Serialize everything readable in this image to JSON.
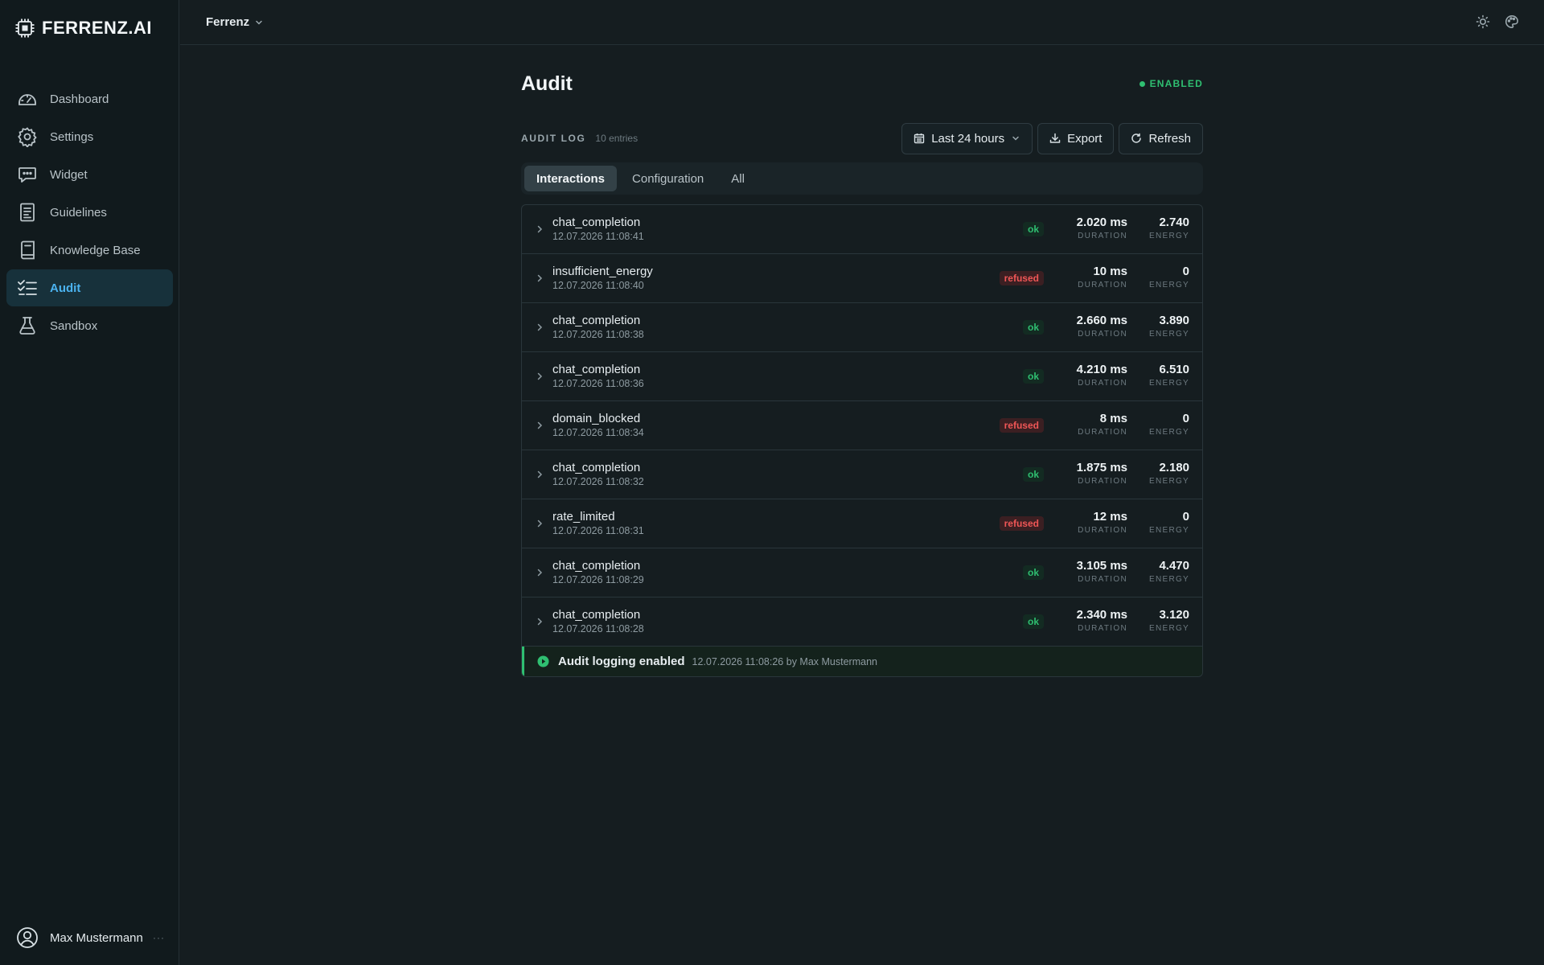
{
  "app": {
    "brand": "FERRENZ.AI"
  },
  "sidebar": {
    "items": [
      {
        "label": "Dashboard",
        "icon": "dashboard-icon"
      },
      {
        "label": "Settings",
        "icon": "gear-icon"
      },
      {
        "label": "Widget",
        "icon": "chat-bubble-icon"
      },
      {
        "label": "Guidelines",
        "icon": "document-icon"
      },
      {
        "label": "Knowledge Base",
        "icon": "book-icon"
      },
      {
        "label": "Audit",
        "icon": "checklist-icon",
        "active": true
      },
      {
        "label": "Sandbox",
        "icon": "flask-icon"
      }
    ],
    "user": {
      "name": "Max Mustermann",
      "more": "···"
    }
  },
  "topbar": {
    "workspace": "Ferrenz"
  },
  "page": {
    "title": "Audit",
    "status": "ENABLED",
    "log_title": "AUDIT LOG",
    "log_count": "10 entries",
    "toolbar": {
      "range": "Last 24 hours",
      "export": "Export",
      "refresh": "Refresh"
    },
    "tabs": [
      "Interactions",
      "Configuration",
      "All"
    ],
    "active_tab": "Interactions"
  },
  "labels": {
    "duration": "DURATION",
    "energy": "ENERGY"
  },
  "entries": [
    {
      "event": "chat_completion",
      "time": "12.07.2026 11:08:41",
      "status": "ok",
      "duration": "2.020 ms",
      "energy": "2.740"
    },
    {
      "event": "insufficient_energy",
      "time": "12.07.2026 11:08:40",
      "status": "refused",
      "duration": "10 ms",
      "energy": "0"
    },
    {
      "event": "chat_completion",
      "time": "12.07.2026 11:08:38",
      "status": "ok",
      "duration": "2.660 ms",
      "energy": "3.890"
    },
    {
      "event": "chat_completion",
      "time": "12.07.2026 11:08:36",
      "status": "ok",
      "duration": "4.210 ms",
      "energy": "6.510"
    },
    {
      "event": "domain_blocked",
      "time": "12.07.2026 11:08:34",
      "status": "refused",
      "duration": "8 ms",
      "energy": "0"
    },
    {
      "event": "chat_completion",
      "time": "12.07.2026 11:08:32",
      "status": "ok",
      "duration": "1.875 ms",
      "energy": "2.180"
    },
    {
      "event": "rate_limited",
      "time": "12.07.2026 11:08:31",
      "status": "refused",
      "duration": "12 ms",
      "energy": "0"
    },
    {
      "event": "chat_completion",
      "time": "12.07.2026 11:08:29",
      "status": "ok",
      "duration": "3.105 ms",
      "energy": "4.470"
    },
    {
      "event": "chat_completion",
      "time": "12.07.2026 11:08:28",
      "status": "ok",
      "duration": "2.340 ms",
      "energy": "3.120"
    }
  ],
  "enabled_entry": {
    "message": "Audit logging enabled",
    "meta": "12.07.2026 11:08:26 by Max Mustermann"
  },
  "colors": {
    "accent": "#4bb3f0",
    "ok": "#2fbf71",
    "refused": "#ef5656",
    "background": "#151d20"
  }
}
